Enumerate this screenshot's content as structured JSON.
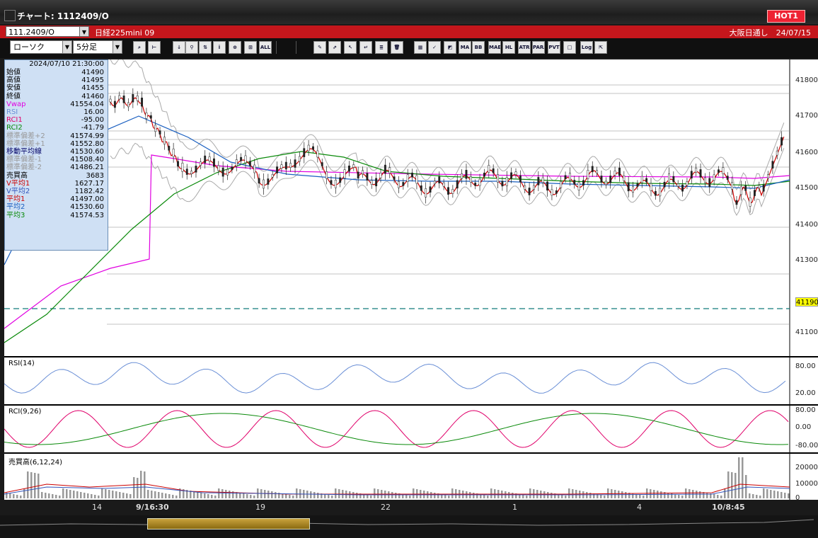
{
  "window": {
    "title": "チャート: 1112409/O",
    "hot_label": "HOT1"
  },
  "symbol_bar": {
    "code": "111.2409/O",
    "name": "日経225mini 09",
    "right_text": "大阪日通し　24/07/15"
  },
  "toolbar": {
    "chart_type": "ローソク",
    "interval": "5分足",
    "icons": [
      "zoom-icon",
      "crosshair-icon",
      "mark-icon",
      "find-icon",
      "compare-icon",
      "info-icon",
      "candle-toggle-icon",
      "bar-toggle-icon",
      "all-icon",
      "trendline-icon",
      "pen-icon",
      "cursor-icon",
      "arrow-icon",
      "memo-icon",
      "trash-icon",
      "settings-icon",
      "tools-icon",
      "color-icon",
      "bollinger-icon",
      "ma-icon",
      "bb-icon",
      "mae-icon",
      "hl-icon",
      "atr-icon",
      "para-icon",
      "pvt-icon",
      "window-icon",
      "log-icon",
      "export-icon"
    ],
    "labels": {
      "all": "ALL",
      "mavg": "MA",
      "bb": "BB",
      "mae": "MAE",
      "hl": "HL",
      "atr": "ATR",
      "para": "PA RA",
      "pvt": "PVT",
      "log": "Log"
    }
  },
  "info_panel": {
    "timestamp": "2024/07/10 21:30:00",
    "rows": [
      {
        "label": "始値",
        "value": "41490",
        "color": "#000000"
      },
      {
        "label": "高値",
        "value": "41495",
        "color": "#000000"
      },
      {
        "label": "安値",
        "value": "41455",
        "color": "#000000"
      },
      {
        "label": "終値",
        "value": "41460",
        "color": "#000000"
      },
      {
        "label": "Vwap",
        "value": "41554.04",
        "color": "#e000e0"
      },
      {
        "label": "RSI",
        "value": "16.00",
        "color": "#6a8fd6"
      },
      {
        "label": "RCI1",
        "value": "-95.00",
        "color": "#e0006a"
      },
      {
        "label": "RCI2",
        "value": "-41.79",
        "color": "#0a8a0a"
      },
      {
        "label": "標準偏差+2",
        "value": "41574.99",
        "color": "#999999"
      },
      {
        "label": "標準偏差+1",
        "value": "41552.80",
        "color": "#999999"
      },
      {
        "label": "移動平均線",
        "value": "41530.60",
        "color": "#000066"
      },
      {
        "label": "標準偏差-1",
        "value": "41508.40",
        "color": "#999999"
      },
      {
        "label": "標準偏差-2",
        "value": "41486.21",
        "color": "#999999"
      },
      {
        "label": "売買高",
        "value": "3683",
        "color": "#000000"
      },
      {
        "label": "V平均1",
        "value": "1627.17",
        "color": "#cc0000"
      },
      {
        "label": "V平均2",
        "value": "1182.42",
        "color": "#3355bb"
      },
      {
        "label": "平均1",
        "value": "41497.00",
        "color": "#cc0000"
      },
      {
        "label": "平均2",
        "value": "41530.60",
        "color": "#1a5fc0"
      },
      {
        "label": "平均3",
        "value": "41574.53",
        "color": "#0a8a0a"
      }
    ]
  },
  "price_axis": [
    "41800",
    "41700",
    "41600",
    "41500",
    "41400",
    "41300",
    "41100"
  ],
  "current_price": "41190",
  "panes": {
    "rsi": {
      "label": "RSI(14)",
      "ticks": [
        "80.00",
        "20.00"
      ]
    },
    "rci": {
      "label": "RCI(9,26)",
      "ticks": [
        "80.00",
        "0.00",
        "-80.00"
      ]
    },
    "vol": {
      "label": "売買高(6,12,24)",
      "ticks": [
        "20000",
        "10000",
        "0"
      ]
    }
  },
  "date_axis": [
    "14",
    "9/16:30",
    "19",
    "22",
    "1",
    "4",
    "10/8:45"
  ],
  "colors": {
    "title_bg": "#2a2a2a",
    "symbol_bar": "#c4161c",
    "chart_bg": "#ffffff",
    "candle": "#222222",
    "ma_fast": "#cc0000",
    "ma_mid": "#1a5fc0",
    "ma_slow": "#0a8a0a",
    "vwap": "#e000e0",
    "bollinger": "#b5b5b5",
    "rsi": "#6a8fd6",
    "rci1": "#e0006a",
    "rci2": "#0a8a0a"
  }
}
